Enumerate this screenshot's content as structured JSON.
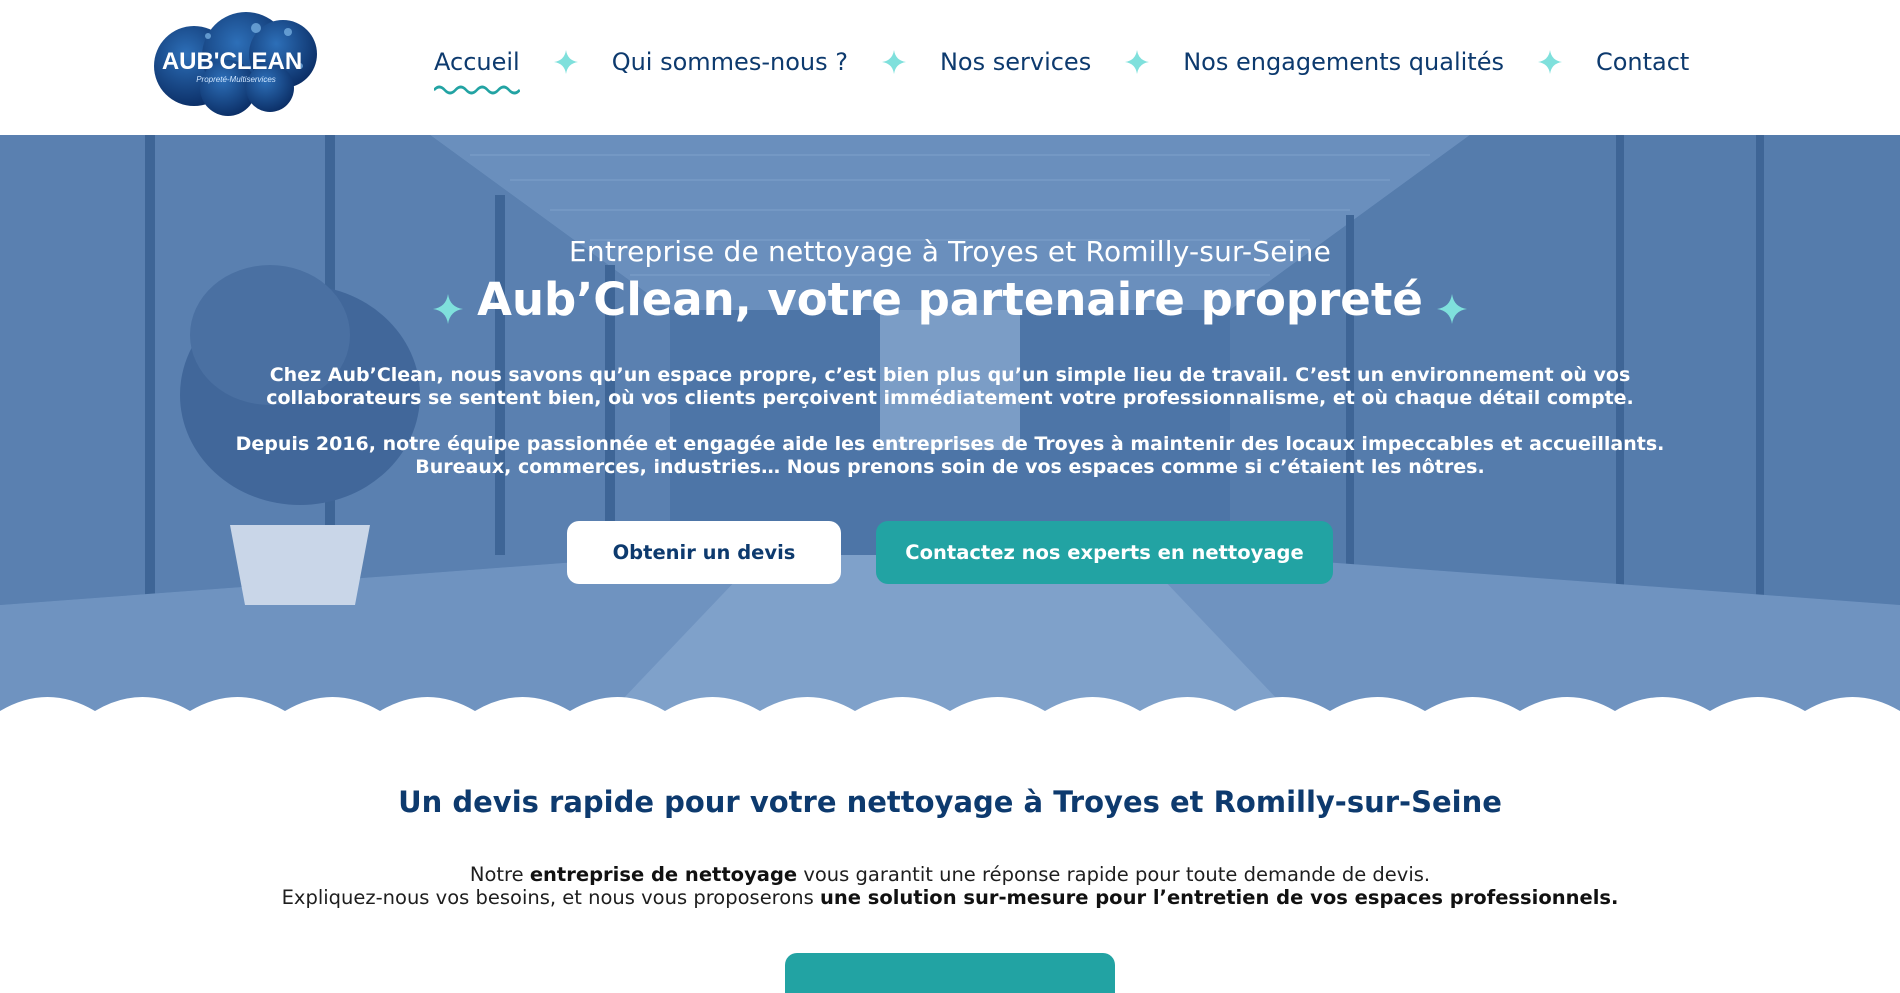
{
  "logo": {
    "main": "AUB'CLEAN",
    "tagline": "Propreté-Multiservices"
  },
  "nav": {
    "items": [
      {
        "label": "Accueil",
        "active": true
      },
      {
        "label": "Qui sommes-nous ?"
      },
      {
        "label": "Nos services"
      },
      {
        "label": "Nos engagements qualités"
      },
      {
        "label": "Contact"
      }
    ]
  },
  "hero": {
    "subtitle": "Entreprise de nettoyage à Troyes et Romilly-sur-Seine",
    "title": "Aub’Clean, votre partenaire propreté",
    "p1_line1": "Chez Aub’Clean, nous savons qu’un espace propre, c’est bien plus qu’un simple lieu de travail. C’est un environnement où vos",
    "p1_line2": "collaborateurs se sentent bien, où vos clients perçoivent immédiatement votre professionnalisme, et où chaque détail compte.",
    "p2_line1": "Depuis 2016, notre équipe passionnée et engagée aide les entreprises de Troyes à maintenir des locaux impeccables et accueillants.",
    "p2_line2": "Bureaux, commerces, industries… Nous prenons soin de vos espaces comme si c’étaient les nôtres.",
    "btn_quote": "Obtenir un devis",
    "btn_contact": "Contactez nos experts en nettoyage"
  },
  "devis": {
    "title": "Un devis rapide pour votre nettoyage à Troyes et Romilly-sur-Seine",
    "l1_a": "Notre ",
    "l1_b": "entreprise de nettoyage",
    "l1_c": " vous garantit une réponse rapide pour toute demande de devis.",
    "l2_a": "Expliquez-nous vos besoins, et nous vous proposerons ",
    "l2_b": "une solution sur-mesure pour l’entretien de vos espaces professionnels."
  },
  "colors": {
    "navy": "#0d3a6e",
    "teal": "#22a3a3",
    "sparkle": "#7fe0dc",
    "hero_overlay": "#4a72a4"
  }
}
